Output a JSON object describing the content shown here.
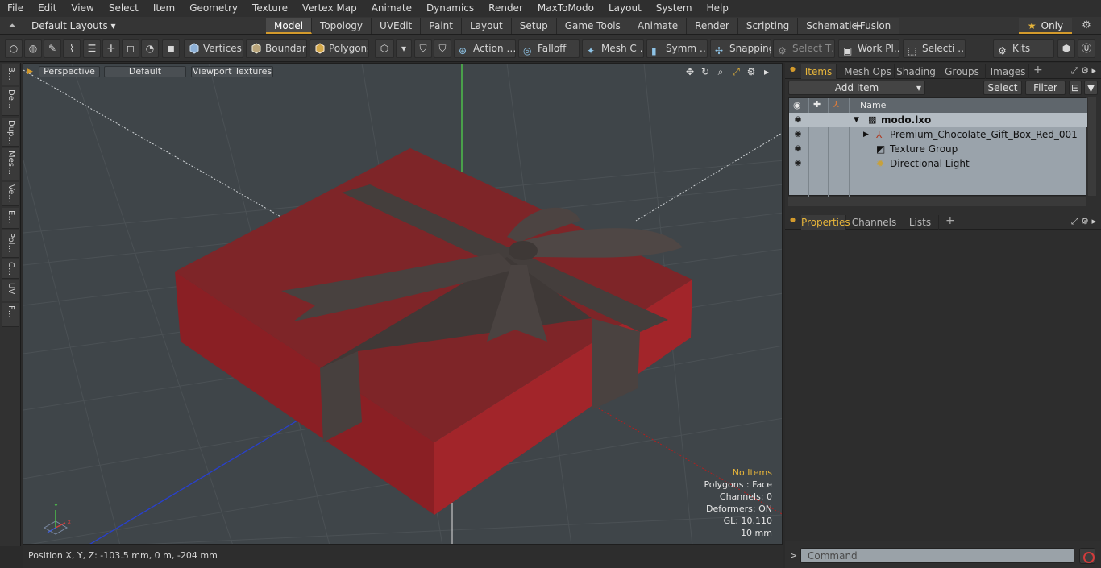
{
  "menu": [
    "File",
    "Edit",
    "View",
    "Select",
    "Item",
    "Geometry",
    "Texture",
    "Vertex Map",
    "Animate",
    "Dynamics",
    "Render",
    "MaxToModo",
    "Layout",
    "System",
    "Help"
  ],
  "layout": {
    "dropdown": "Default Layouts ▾",
    "tabs": [
      "Model",
      "Topology",
      "UVEdit",
      "Paint",
      "Layout",
      "Setup",
      "Game Tools",
      "Animate",
      "Render",
      "Scripting",
      "Schematic Fusion"
    ],
    "active_tab": "Model",
    "add_tab": "+",
    "only_label": "Only",
    "only_star": "★"
  },
  "toolbar": {
    "vertices": "Vertices",
    "boundary": "Boundary",
    "polygons": "Polygons",
    "action": "Action …",
    "falloff": "Falloff",
    "mesh": "Mesh C …",
    "symmetry": "Symm …",
    "snapping": "Snapping",
    "select_t": "Select T…",
    "work_plane": "Work Pl…",
    "selection": "Selecti …",
    "kits": "Kits"
  },
  "left_tabs": [
    "B…",
    "De…",
    "Dup…",
    "Mes…",
    "Ve…",
    "E…",
    "Pol…",
    "C…",
    "UV",
    "F…"
  ],
  "viewport": {
    "view_mode": "Perspective",
    "shading": "Default",
    "textures": "Viewport Textures",
    "info": {
      "items": "No Items",
      "polygons": "Polygons : Face",
      "channels": "Channels: 0",
      "deformers": "Deformers: ON",
      "gl": "GL: 10,110",
      "scale": "10 mm"
    },
    "gizmo": {
      "x": "X",
      "y": "Y"
    },
    "colors": {
      "box": "#8b2a2c",
      "box_side": "#a3262a",
      "ribbon": "#4a4341",
      "grid": "#4a5054"
    }
  },
  "status": {
    "position": "Position X, Y, Z:   -103.5 mm, 0 m, -204 mm"
  },
  "items_panel": {
    "tabs": [
      "Items",
      "Mesh Ops",
      "Shading",
      "Groups",
      "Images"
    ],
    "active_tab": "Items",
    "add_item": "Add Item",
    "select": "Select",
    "filter": "Filter",
    "column_name": "Name",
    "rows": [
      {
        "name": "modo.lxo",
        "bold": true
      },
      {
        "name": "Premium_Chocolate_Gift_Box_Red_001"
      },
      {
        "name": "Texture Group"
      },
      {
        "name": "Directional Light"
      }
    ]
  },
  "properties_panel": {
    "tabs": [
      "Properties",
      "Channels",
      "Lists"
    ],
    "active_tab": "Properties"
  },
  "command": {
    "placeholder": "Command"
  }
}
